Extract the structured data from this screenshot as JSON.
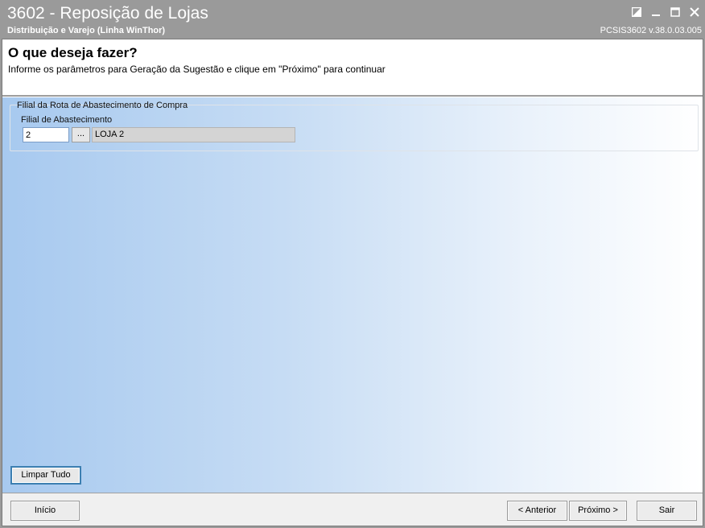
{
  "window": {
    "title": "3602 - Reposição de Lojas",
    "subtitle": "Distribuição e Varejo (Linha WinThor)",
    "version": "PCSIS3602  v.38.0.03.005",
    "controls": [
      "restore-icon",
      "minimize-icon",
      "maximize-icon",
      "close-icon"
    ]
  },
  "header": {
    "title": "O que deseja fazer?",
    "description": "Informe os parâmetros para Geração da Sugestão e clique em \"Próximo\" para continuar"
  },
  "group": {
    "legend": "Filial da Rota de Abastecimento de Compra",
    "field_label": "Filial de Abastecimento",
    "field_value": "2",
    "lookup_label": "...",
    "display_value": "LOJA 2"
  },
  "actions": {
    "clear_label": "Limpar Tudo"
  },
  "footer": {
    "inicio_label": "Início",
    "anterior_label": "< Anterior",
    "proximo_label": "Próximo >",
    "sair_label": "Sair"
  },
  "colors": {
    "titlebar": "#9a9a9a",
    "gradient_start": "#a7c9ef",
    "gradient_end": "#ffffff",
    "focus_border": "#3c7fb1"
  }
}
